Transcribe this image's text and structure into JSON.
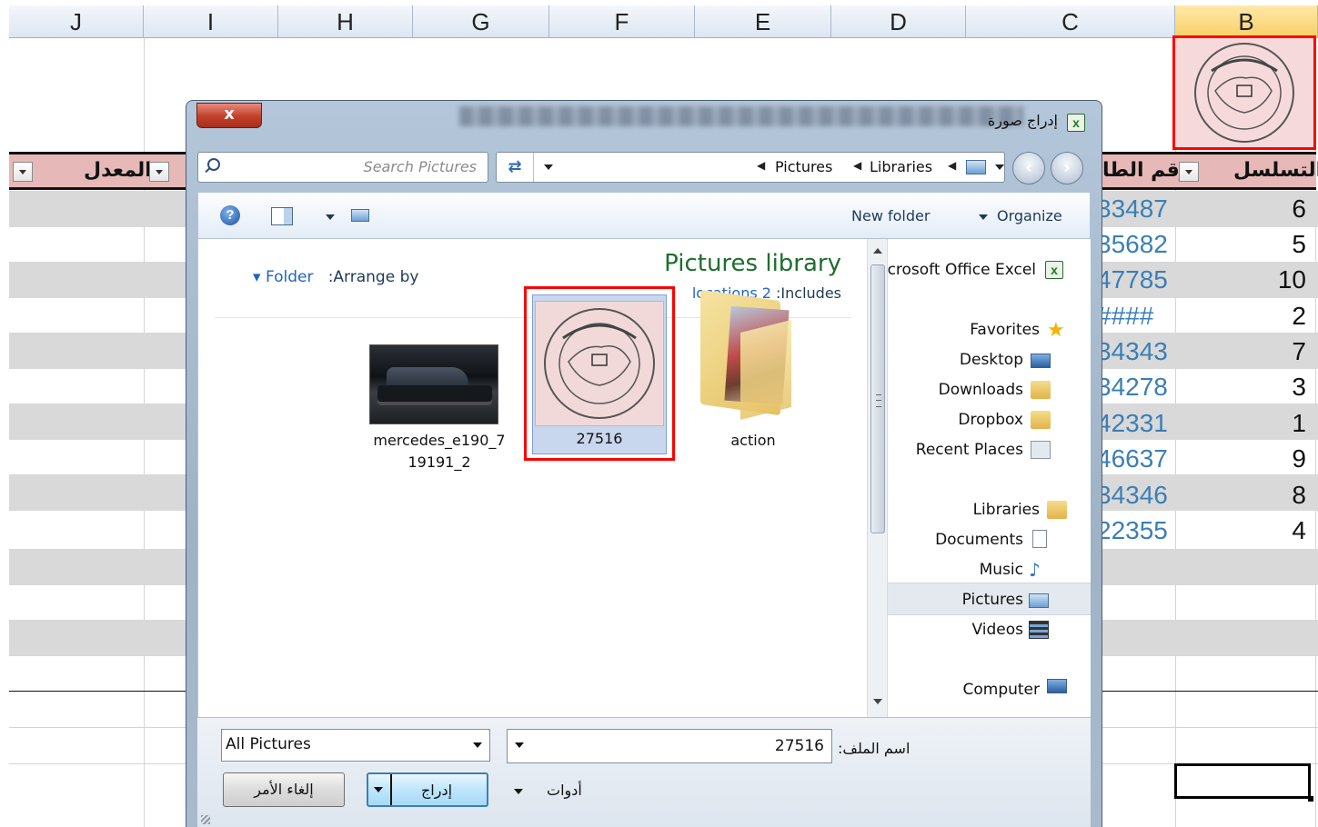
{
  "sheet": {
    "columns": [
      "J",
      "I",
      "H",
      "G",
      "F",
      "E",
      "D",
      "C",
      "B"
    ],
    "selected_column": "B",
    "headers": {
      "average": "المعدل",
      "student_id": "رقم الطا",
      "serial": "التسلسل"
    },
    "rows": [
      {
        "serial": "6",
        "id": "33487"
      },
      {
        "serial": "5",
        "id": "35682"
      },
      {
        "serial": "10",
        "id": "47785"
      },
      {
        "serial": "2",
        "id": "####"
      },
      {
        "serial": "7",
        "id": "34343"
      },
      {
        "serial": "3",
        "id": "34278"
      },
      {
        "serial": "1",
        "id": "42331"
      },
      {
        "serial": "9",
        "id": "46637"
      },
      {
        "serial": "8",
        "id": "34346"
      },
      {
        "serial": "4",
        "id": "22355"
      }
    ]
  },
  "dialog": {
    "title": "إدراج صورة",
    "close_label": "x",
    "search_placeholder": "Search Pictures",
    "breadcrumb": [
      "Pictures",
      "Libraries"
    ],
    "toolbar": {
      "organize": "Organize",
      "new_folder": "New folder"
    },
    "library": {
      "title": "Pictures library",
      "includes_label": ":Includes",
      "locations": "locations 2",
      "arrange_label": ":Arrange by",
      "arrange_value": "Folder"
    },
    "files": [
      {
        "name": "mercedes_e190_719191_2",
        "line1": "mercedes_e190_7",
        "line2": "19191_2",
        "icon": "car-photo"
      },
      {
        "name": "27516",
        "icon": "seal-image",
        "selected": true
      },
      {
        "name": "action",
        "icon": "folder-icon"
      }
    ],
    "nav": {
      "top_item": "crosoft Office Excel",
      "favorites": "Favorites",
      "desktop": "Desktop",
      "downloads": "Downloads",
      "dropbox": "Dropbox",
      "recent": "Recent Places",
      "libraries": "Libraries",
      "documents": "Documents",
      "music": "Music",
      "pictures": "Pictures",
      "videos": "Videos",
      "computer": "Computer",
      "selected": "Pictures"
    },
    "filename_label": "اسم الملف:",
    "filename_value": "27516",
    "filter_value": "All Pictures",
    "tools_label": "أدوات",
    "insert_label": "إدراج",
    "cancel_label": "إلغاء الأمر"
  },
  "colors": {
    "header_band": "#e6b9b8",
    "selection": "#ff0000",
    "link": "#1e64c8",
    "library_title": "#1e6e2e"
  }
}
